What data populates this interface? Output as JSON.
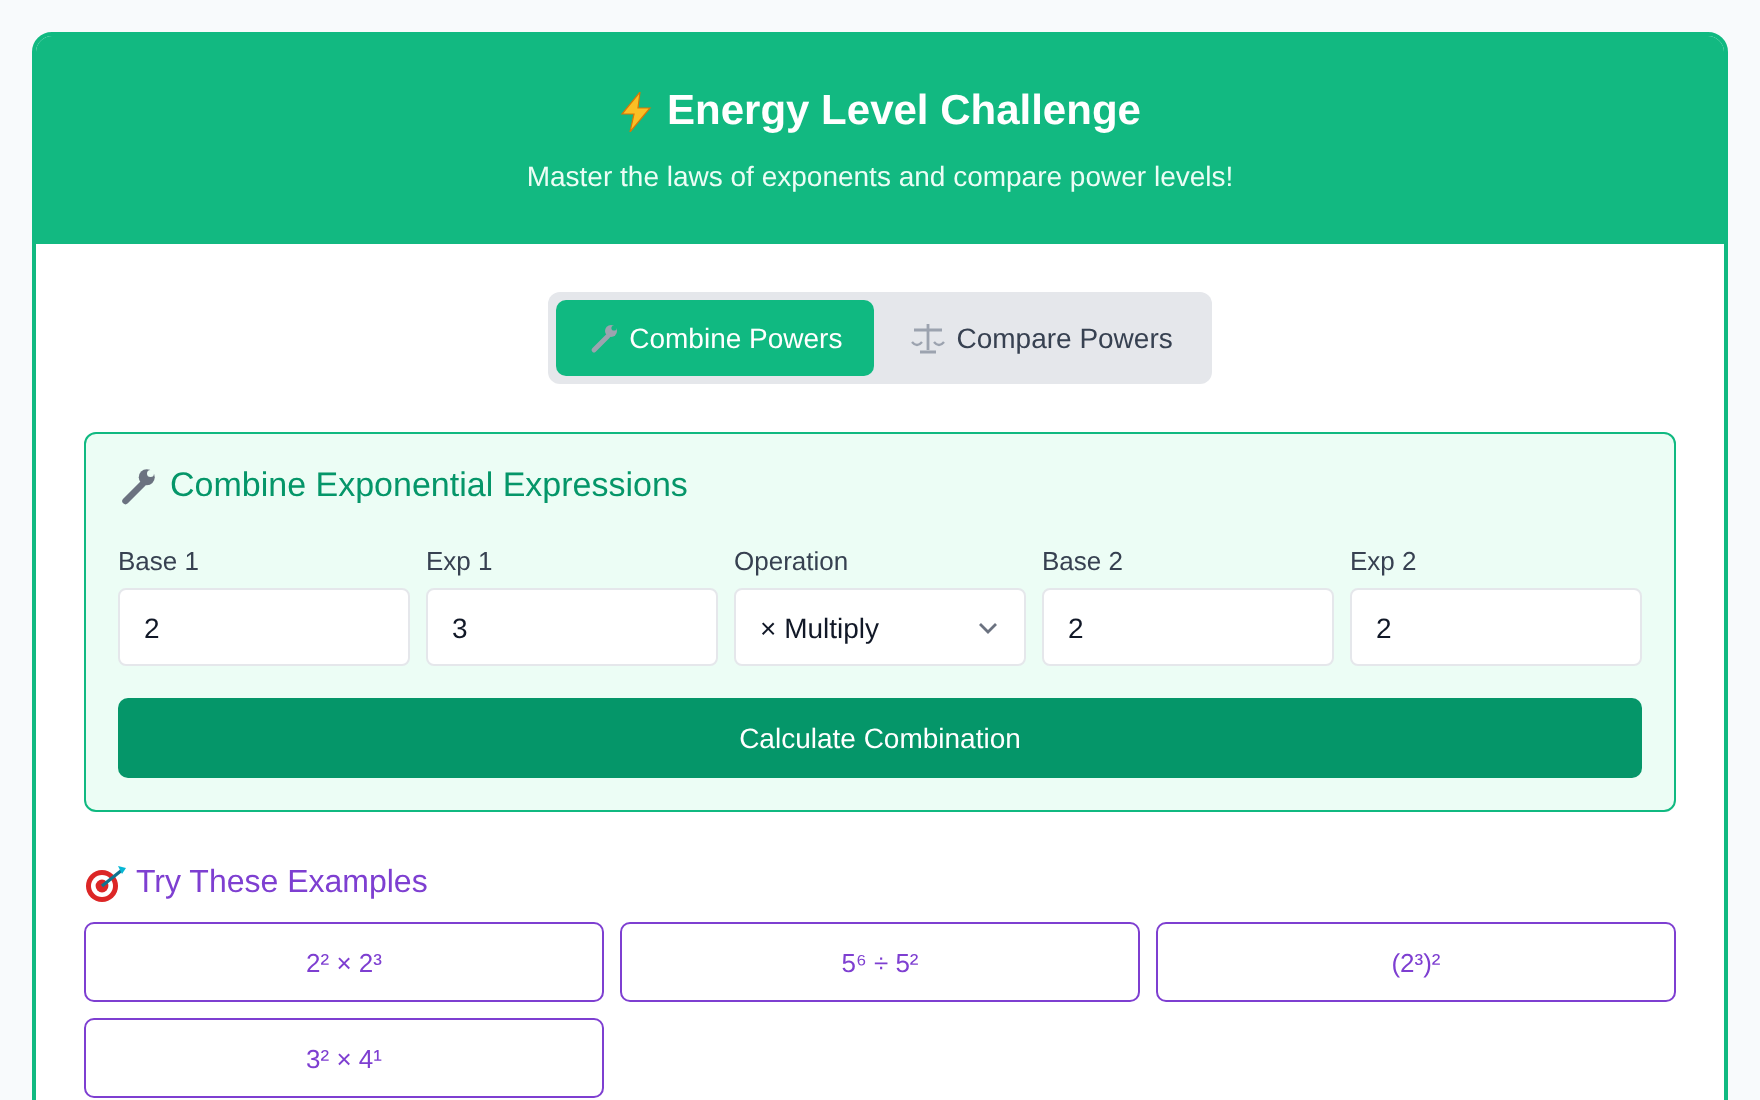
{
  "header": {
    "title": "Energy Level Challenge",
    "subtitle": "Master the laws of exponents and compare power levels!"
  },
  "tabs": [
    {
      "label": "Combine Powers",
      "kind": "wrench",
      "selected": true
    },
    {
      "label": "Compare Powers",
      "kind": "scale",
      "selected": false
    }
  ],
  "panel": {
    "title": "Combine Exponential Expressions",
    "fields": [
      {
        "label": "Base 1",
        "kind": "input",
        "value": "2"
      },
      {
        "label": "Exp 1",
        "kind": "input",
        "value": "3"
      },
      {
        "label": "Operation",
        "kind": "select",
        "value": "× Multiply"
      },
      {
        "label": "Base 2",
        "kind": "input",
        "value": "2"
      },
      {
        "label": "Exp 2",
        "kind": "input",
        "value": "2"
      }
    ],
    "button": "Calculate Combination"
  },
  "examples": {
    "title": "Try These Examples",
    "items": [
      "2² × 2³",
      "5⁶ ÷ 5²",
      "(2³)²",
      "3² × 4¹"
    ]
  }
}
